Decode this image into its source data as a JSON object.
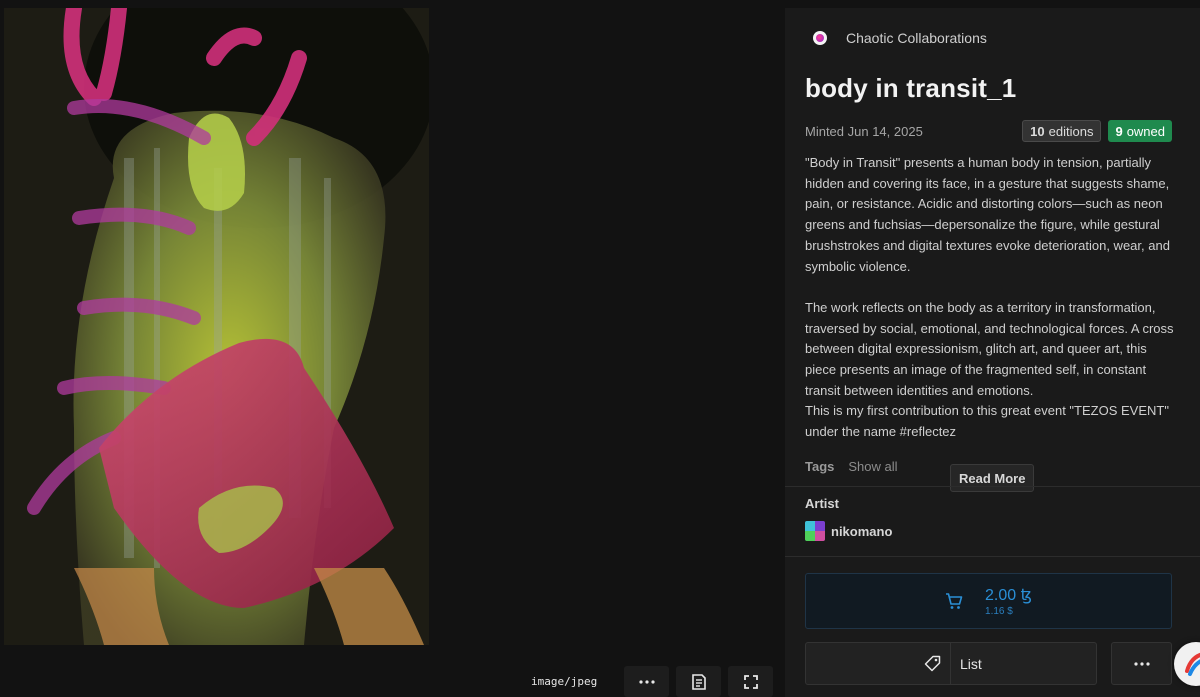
{
  "media": {
    "mime_type": "image/jpeg",
    "toolbar": {
      "more_icon": "ellipsis-icon",
      "info_icon": "document-icon",
      "fullscreen_icon": "fullscreen-icon"
    }
  },
  "token": {
    "collection": "Chaotic Collaborations",
    "title": "body in transit_1",
    "minted": "Minted Jun 14, 2025",
    "editions_count": "10",
    "editions_label": "editions",
    "owned_count": "9",
    "owned_label": "owned",
    "description": [
      "\"Body in Transit\" presents a human body in tension, partially hidden and covering its face, in a gesture that suggests shame, pain, or resistance. Acidic and distorting colors—such as neon greens and fuchsias—depersonalize the figure, while gestural brushstrokes and digital textures evoke deterioration, wear, and symbolic violence.",
      "The work reflects on the body as a territory in transformation, traversed by social, emotional, and technological forces. A cross between digital expressionism, glitch art, and queer art, this piece presents an image of the fragmented self, in constant transit between identities and emotions.",
      "This is my first contribution to this great event \"TEZOS EVENT\" under the name #reflectez"
    ],
    "tags_label": "Tags",
    "tags_show_all": "Show all",
    "read_more": "Read More",
    "artist_label": "Artist",
    "artist_name": "nikomano"
  },
  "purchase": {
    "price": "2.00 ꜩ",
    "price_fiat": "1.16 $",
    "list_label": "List"
  },
  "colors": {
    "accent_blue": "#2a8fd6",
    "owned_green": "#1f8a4e"
  }
}
